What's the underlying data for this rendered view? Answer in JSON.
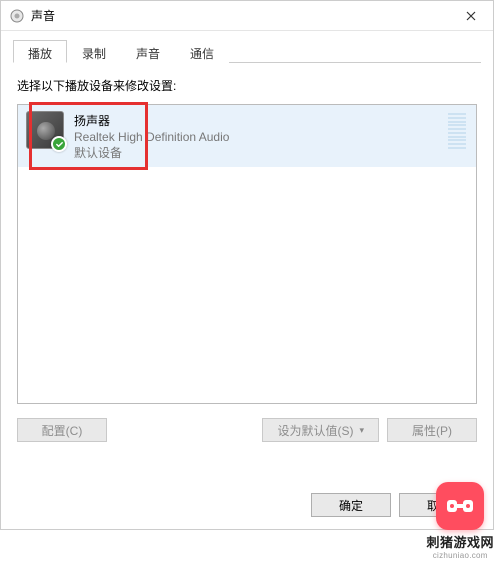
{
  "window": {
    "title": "声音"
  },
  "tabs": [
    {
      "label": "播放",
      "active": true
    },
    {
      "label": "录制",
      "active": false
    },
    {
      "label": "声音",
      "active": false
    },
    {
      "label": "通信",
      "active": false
    }
  ],
  "instruction": "选择以下播放设备来修改设置:",
  "device": {
    "name": "扬声器",
    "description": "Realtek High Definition Audio",
    "default_label": "默认设备"
  },
  "buttons": {
    "configure": "配置(C)",
    "set_default": "设为默认值(S)",
    "properties": "属性(P)",
    "ok": "确定",
    "cancel": "取消"
  },
  "watermark": {
    "name": "刺猪游戏网",
    "domain": "cizhuniao.com"
  }
}
